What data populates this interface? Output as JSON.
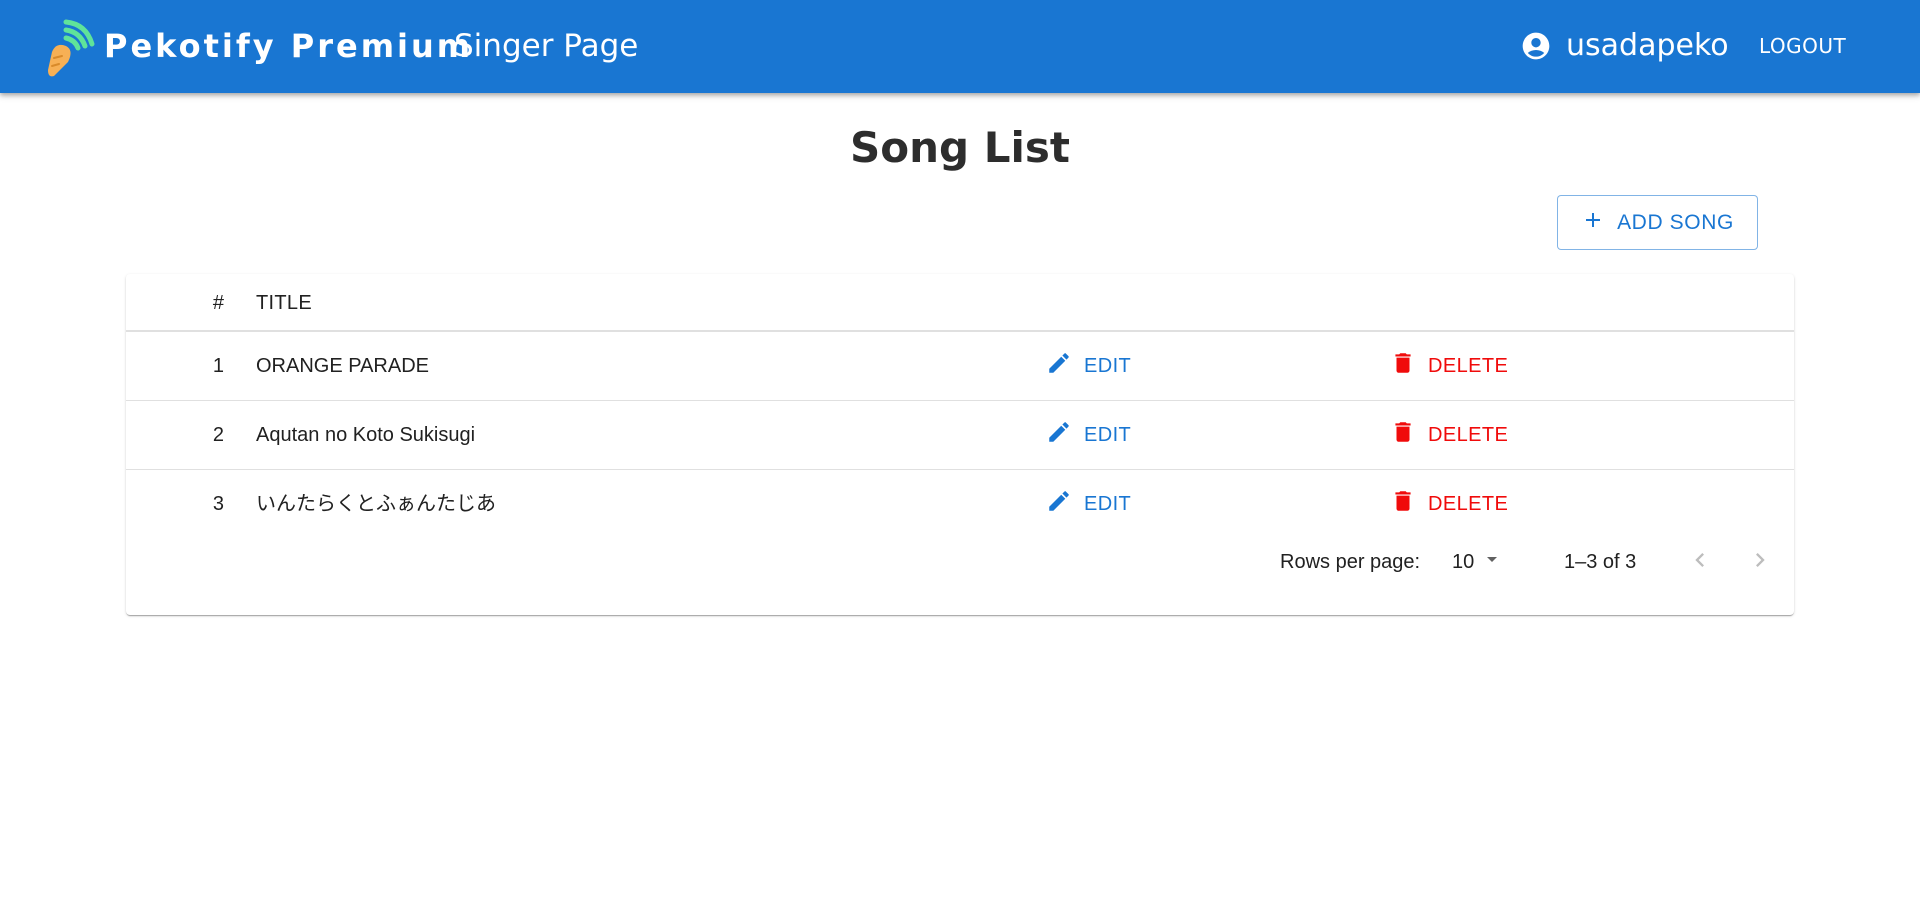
{
  "header": {
    "brand": "Pekotify Premium",
    "subtitle": "Singer Page",
    "username": "usadapeko",
    "logout_label": "LOGOUT",
    "logo_icon": "carrot-logo-icon",
    "user_icon": "account-circle-icon",
    "bg_color": "#1976d2"
  },
  "main": {
    "title": "Song List",
    "add_button_label": "ADD SONG",
    "add_button_icon": "plus-icon"
  },
  "table": {
    "headers": {
      "num": "#",
      "title": "TITLE"
    },
    "edit_label": "EDIT",
    "delete_label": "DELETE",
    "edit_icon": "pencil-icon",
    "delete_icon": "trash-icon",
    "edit_color": "#1976d2",
    "delete_color": "#f00b0b",
    "rows": [
      {
        "num": "1",
        "title": "ORANGE PARADE"
      },
      {
        "num": "2",
        "title": "Aqutan no Koto Sukisugi"
      },
      {
        "num": "3",
        "title": "いんたらくとふぁんたじあ"
      }
    ]
  },
  "pagination": {
    "rows_per_page_label": "Rows per page:",
    "rows_per_page_value": "10",
    "range_text": "1–3 of 3",
    "prev_enabled": false,
    "next_enabled": false
  }
}
